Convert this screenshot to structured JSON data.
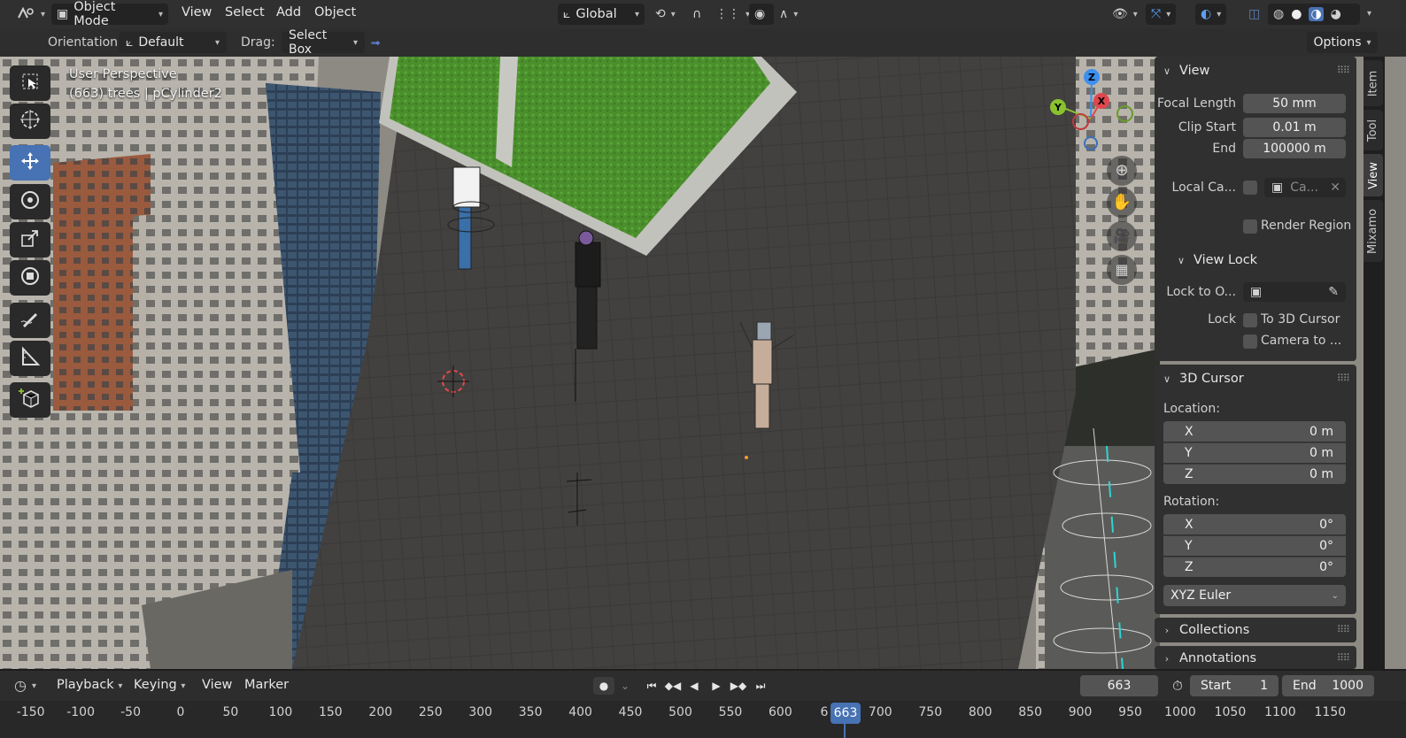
{
  "header": {
    "mode": "Object Mode",
    "menus": [
      "View",
      "Select",
      "Add",
      "Object"
    ],
    "transform_orientation": "Global"
  },
  "tool_settings": {
    "orientation_label": "Orientation:",
    "orientation_value": "Default",
    "drag_label": "Drag:",
    "drag_value": "Select Box",
    "options_label": "Options"
  },
  "viewport": {
    "view_name": "User Perspective",
    "object_info": "(663) trees | pCylinder2",
    "gizmo_axes": [
      "X",
      "Y",
      "Z"
    ],
    "colors": {
      "x_axis": "#e0474f",
      "y_axis": "#8ac22f",
      "z_axis": "#3d8ff0",
      "active_tool": "#4772b3"
    }
  },
  "sidebar": {
    "tabs": [
      "Item",
      "Tool",
      "View",
      "Mixamo"
    ],
    "active_tab": "View",
    "view_panel": {
      "title": "View",
      "focal_length_label": "Focal Length",
      "focal_length": "50 mm",
      "clip_start_label": "Clip Start",
      "clip_start": "0.01 m",
      "clip_end_label": "End",
      "clip_end": "100000 m",
      "local_camera_label": "Local Ca...",
      "local_camera_value": "Ca...",
      "render_region_label": "Render Region"
    },
    "view_lock_panel": {
      "title": "View Lock",
      "lock_to_object_label": "Lock to O...",
      "lock_label": "Lock",
      "to_3d_cursor_label": "To 3D Cursor",
      "camera_to_label": "Camera to ..."
    },
    "cursor_panel": {
      "title": "3D Cursor",
      "location_label": "Location:",
      "location": [
        {
          "axis": "X",
          "value": "0 m"
        },
        {
          "axis": "Y",
          "value": "0 m"
        },
        {
          "axis": "Z",
          "value": "0 m"
        }
      ],
      "rotation_label": "Rotation:",
      "rotation": [
        {
          "axis": "X",
          "value": "0°"
        },
        {
          "axis": "Y",
          "value": "0°"
        },
        {
          "axis": "Z",
          "value": "0°"
        }
      ],
      "rotation_mode": "XYZ Euler"
    },
    "collapsed_panels": [
      "Collections",
      "Annotations"
    ]
  },
  "timeline": {
    "menus": [
      "Playback",
      "Keying",
      "View",
      "Marker"
    ],
    "current_frame": "663",
    "start_label": "Start",
    "start_value": "1",
    "end_label": "End",
    "end_value": "1000",
    "ruler_ticks": [
      "-150",
      "-100",
      "-50",
      "0",
      "50",
      "100",
      "150",
      "200",
      "250",
      "300",
      "350",
      "400",
      "450",
      "500",
      "550",
      "600",
      "6",
      "700",
      "750",
      "800",
      "850",
      "900",
      "950",
      "1000",
      "1050",
      "1100",
      "1150"
    ],
    "playhead_label": "663"
  }
}
